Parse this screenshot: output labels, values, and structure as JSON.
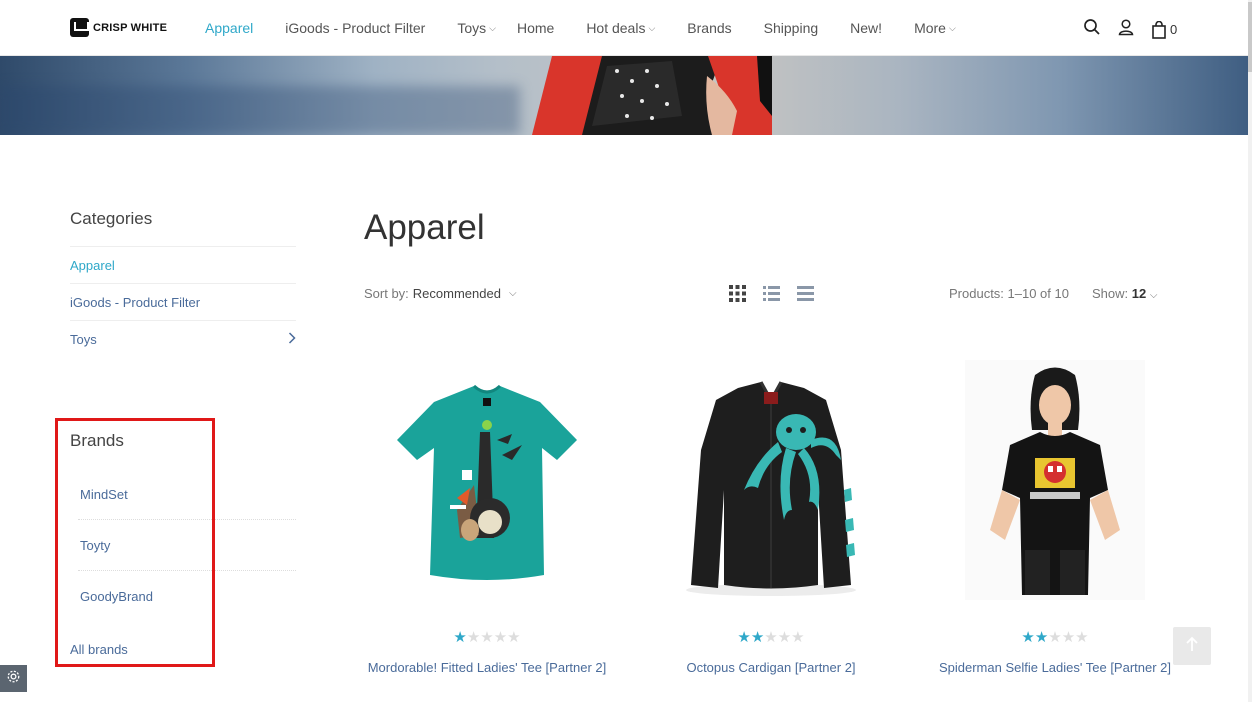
{
  "logo": {
    "text": "CRISP WHITE"
  },
  "nav": {
    "items": [
      {
        "label": "Apparel",
        "active": true,
        "dropdown": false
      },
      {
        "label": "iGoods - Product Filter",
        "active": false,
        "dropdown": false
      },
      {
        "label": "Toys",
        "active": false,
        "dropdown": true
      },
      {
        "label": "Home",
        "active": false,
        "dropdown": false
      },
      {
        "label": "Hot deals",
        "active": false,
        "dropdown": true
      },
      {
        "label": "Brands",
        "active": false,
        "dropdown": false
      },
      {
        "label": "Shipping",
        "active": false,
        "dropdown": false
      },
      {
        "label": "New!",
        "active": false,
        "dropdown": false
      },
      {
        "label": "More",
        "active": false,
        "dropdown": true
      }
    ],
    "cart_count": "0"
  },
  "sidebar": {
    "categories_title": "Categories",
    "categories": [
      "Apparel",
      "iGoods - Product Filter",
      "Toys"
    ],
    "brands_title": "Brands",
    "brands": [
      "MindSet",
      "Toyty",
      "GoodyBrand"
    ],
    "all_brands": "All brands"
  },
  "main": {
    "title": "Apparel",
    "sort_label": "Sort by:",
    "sort_value": "Recommended",
    "products_count": "Products: 1–10 of 10",
    "show_label": "Show:",
    "show_value": "12"
  },
  "products": [
    {
      "name": "Mordorable! Fitted Ladies' Tee [Partner 2]",
      "rating": 1
    },
    {
      "name": "Octopus Cardigan [Partner 2]",
      "rating": 2
    },
    {
      "name": "Spiderman Selfie Ladies' Tee [Partner 2]",
      "rating": 2
    }
  ],
  "colors": {
    "accent": "#2fa8c9",
    "link": "#4a6b9a",
    "highlight": "#e01818"
  }
}
